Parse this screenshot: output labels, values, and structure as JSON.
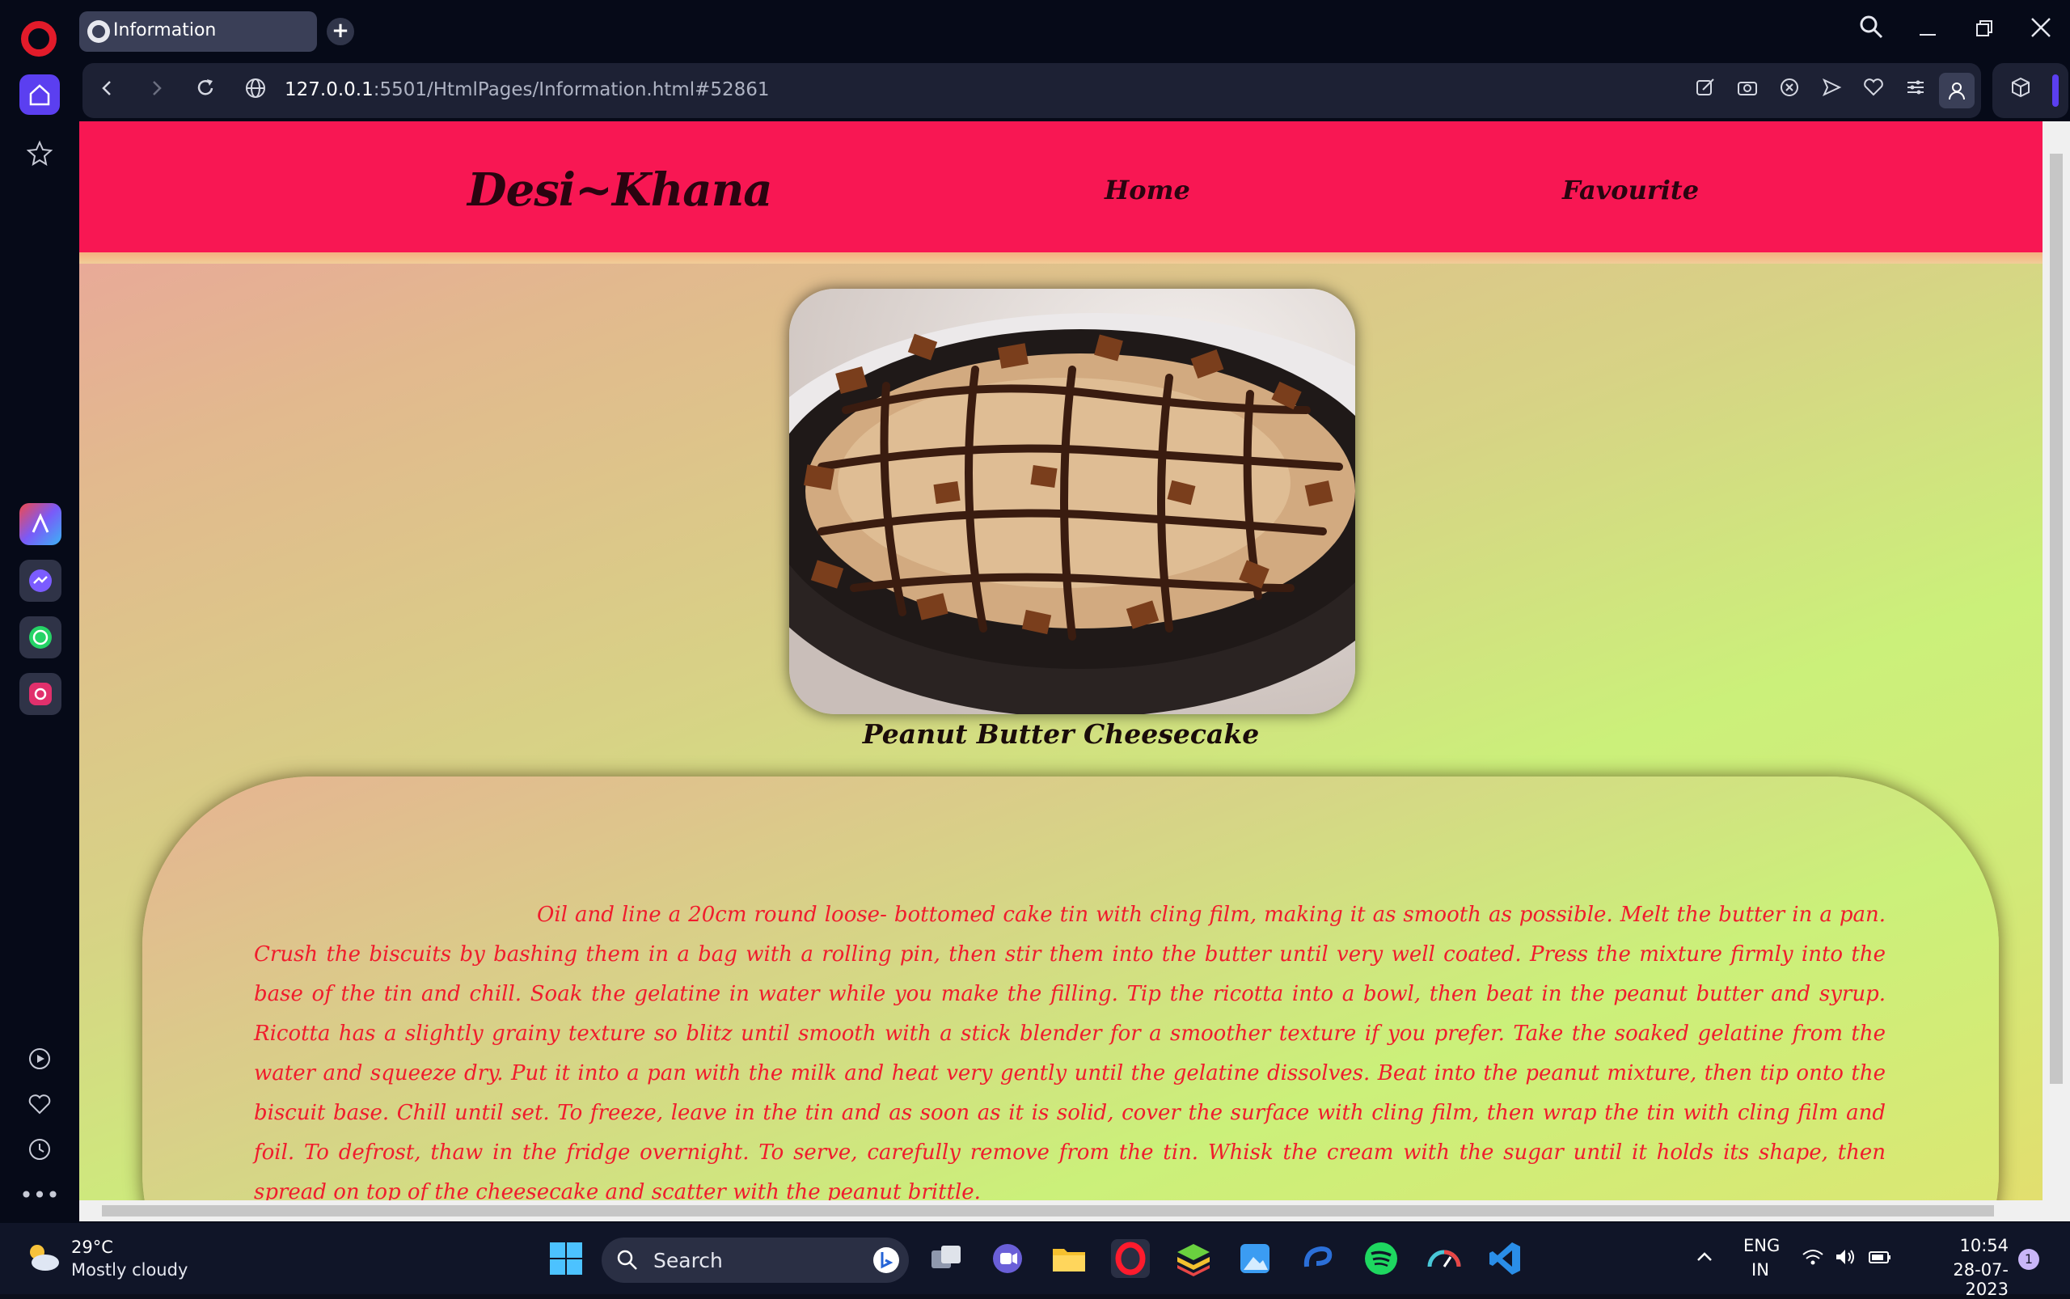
{
  "browser": {
    "tab_title": "Information",
    "new_tab_symbol": "+",
    "url_host": "127.0.0.1",
    "url_rest": ":5501/HtmlPages/Information.html#52861",
    "window_controls": [
      "search-icon",
      "minimize-icon",
      "restore-icon",
      "close-icon"
    ],
    "toolbar_icons": [
      "edit-icon",
      "camera-icon",
      "adblock-icon",
      "send-icon",
      "heart-icon",
      "settings-icon",
      "profile-icon",
      "extensions-icon"
    ],
    "sidebar_icons": [
      "home-icon",
      "star-icon",
      "aria-icon",
      "messenger-icon",
      "whatsapp-icon",
      "instagram-icon",
      "player-icon",
      "heart-icon",
      "history-icon",
      "more-icon"
    ],
    "accent_color": "#5b3ff0"
  },
  "site": {
    "brand": "Desi~Khana",
    "nav": [
      {
        "label": "Home"
      },
      {
        "label": "Favourite"
      }
    ],
    "header_color": "#f81753",
    "dish": {
      "caption": "Peanut Butter Cheesecake",
      "image_alt": "peanut butter cheesecake with chocolate drizzle"
    },
    "recipe": {
      "text": "Oil and line a 20cm round loose- bottomed cake tin with cling film, making it as smooth as possible. Melt the butter in a pan. Crush the biscuits by bashing them in a bag with a rolling pin, then stir them into the butter until very well coated. Press the mixture firmly into the base of the tin and chill. Soak the gelatine in water while you make the filling. Tip the ricotta into a bowl, then beat in the peanut butter and syrup. Ricotta has a slightly grainy texture so blitz until smooth with a stick blender for a smoother texture if you prefer. Take the soaked gelatine from the water and squeeze dry. Put it into a pan with the milk and heat very gently until the gelatine dissolves. Beat into the peanut mixture, then tip onto the biscuit base. Chill until set. To freeze, leave in the tin and as soon as it is solid, cover the surface with cling film, then wrap the tin with cling film and foil. To defrost, thaw in the fridge overnight. To serve, carefully remove from the tin. Whisk the cream with the sugar until it holds its shape, then spread on top of the cheesecake and scatter with the peanut brittle.",
      "text_color": "#f01c2c"
    }
  },
  "taskbar": {
    "weather_temp": "29°C",
    "weather_desc": "Mostly cloudy",
    "search_label": "Search",
    "lang_line1": "ENG",
    "lang_line2": "IN",
    "time": "10:54",
    "date": "28-07-2023",
    "notification_count": "1"
  }
}
